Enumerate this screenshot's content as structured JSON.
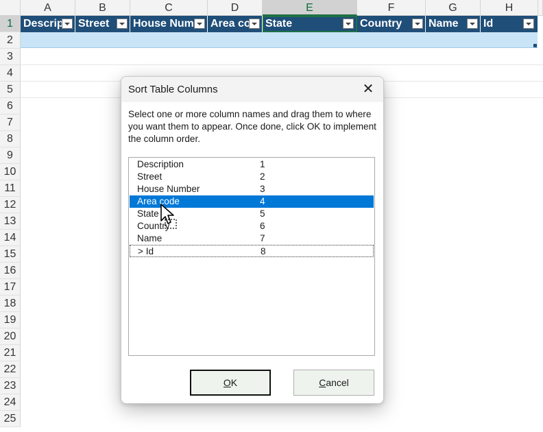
{
  "sheet": {
    "columns": [
      "A",
      "B",
      "C",
      "D",
      "E",
      "F",
      "G",
      "H"
    ],
    "selected_column": "E",
    "rows": [
      "1",
      "2",
      "3",
      "4",
      "5",
      "6",
      "7",
      "8",
      "9",
      "10",
      "11",
      "12",
      "13",
      "14",
      "15",
      "16",
      "17",
      "18",
      "19",
      "20",
      "21",
      "22",
      "23",
      "24",
      "25"
    ],
    "selected_row": "1",
    "table_headers": [
      "Descrip",
      "Street",
      "House Num",
      "Area co",
      "State",
      "Country",
      "Name",
      "Id"
    ],
    "colors": {
      "table_header_bg": "#1f4e79",
      "table_row_bg": "#c9e4f6",
      "selection": "#1e7145"
    }
  },
  "dialog": {
    "title": "Sort Table Columns",
    "close_icon": "close-icon",
    "instructions": "Select one or more column names and drag them to where you want them to appear. Once done, click OK to implement the column order.",
    "items": [
      {
        "name": "Description",
        "order": "1"
      },
      {
        "name": "Street",
        "order": "2"
      },
      {
        "name": "House Number",
        "order": "3"
      },
      {
        "name": "Area code",
        "order": "4"
      },
      {
        "name": "State",
        "order": "5"
      },
      {
        "name": "Country",
        "order": "6"
      },
      {
        "name": "Name",
        "order": "7"
      },
      {
        "name": "> Id",
        "order": "8"
      }
    ],
    "selected_item": "Area code",
    "ok_label": {
      "accel": "O",
      "rest": "K"
    },
    "cancel_label": {
      "accel": "C",
      "rest": "ancel"
    },
    "colors": {
      "selection": "#0078d7",
      "button_bg": "#eef4ed"
    }
  }
}
